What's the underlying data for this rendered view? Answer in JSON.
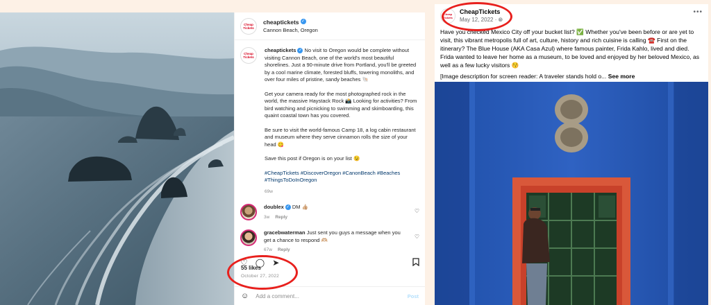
{
  "instagram": {
    "header": {
      "username": "cheaptickets",
      "location": "Cannon Beach, Oregon",
      "logo_text": "Cheap Tickets"
    },
    "caption": {
      "username": "cheaptickets",
      "p1": "No visit to Oregon would be complete without visiting Cannon Beach, one of the world's most beautiful shorelines. Just a 90-minute drive from Portland, you'll be greeted by a cool marine climate, forested bluffs, towering monoliths, and over four miles of pristine, sandy beaches 🐚",
      "p2": "Get your camera ready for the most photographed rock in the world, the massive Haystack Rock 📸 Looking for activities? From bird watching and picnicking to swimming and skimboarding, this quaint coastal town has you covered.",
      "p3": "Be sure to visit the world-famous Camp 18, a log cabin restaurant and museum where they serve cinnamon rolls the size of your head 😋",
      "p4": "Save this post if Oregon is on your list 😉",
      "hashtags": "#CheapTickets #DiscoverOregon #CanonBeach #Beaches #ThingsToDoInOregon",
      "age": "69w"
    },
    "comments": [
      {
        "username": "doublex",
        "text": "DM 👍🏼",
        "age": "3w",
        "reply": "Reply"
      },
      {
        "username": "gracebwaterman",
        "text": "Just sent you guys a message when you get a chance to respond 🫶🏼",
        "age": "67w",
        "reply": "Reply"
      }
    ],
    "likes": "55 likes",
    "date": "October 27, 2022",
    "add_comment_placeholder": "Add a comment...",
    "post_label": "Post",
    "icons": [
      "heart-icon",
      "comment-icon",
      "share-icon",
      "bookmark-icon",
      "emoji-icon",
      "more-icon",
      "verified-icon"
    ]
  },
  "facebook": {
    "name": "CheapTickets",
    "date": "May 12, 2022",
    "logo_text": "Cheap Tickets",
    "text": "Have you checked Mexico City off your bucket list? ✅ Whether you've been before or are yet to visit, this vibrant metropolis full of art, culture, history and rich cuisine is calling ☎️ First on the itinerary? The Blue House (AKA Casa Azul) where famous painter, Frida Kahlo, lived and died. Frida wanted to leave her home as a museum, to be loved and enjoyed by her beloved Mexico, as well as a few lucky visitors 😚",
    "image_desc": "[Image description for screen reader: A traveler stands hold o...",
    "see_more": "See more"
  },
  "colors": {
    "highlight": "#e8201d",
    "background": "#fdf1e6",
    "brand": "#d6001c",
    "link": "#00376b",
    "verified": "#3897f0"
  }
}
